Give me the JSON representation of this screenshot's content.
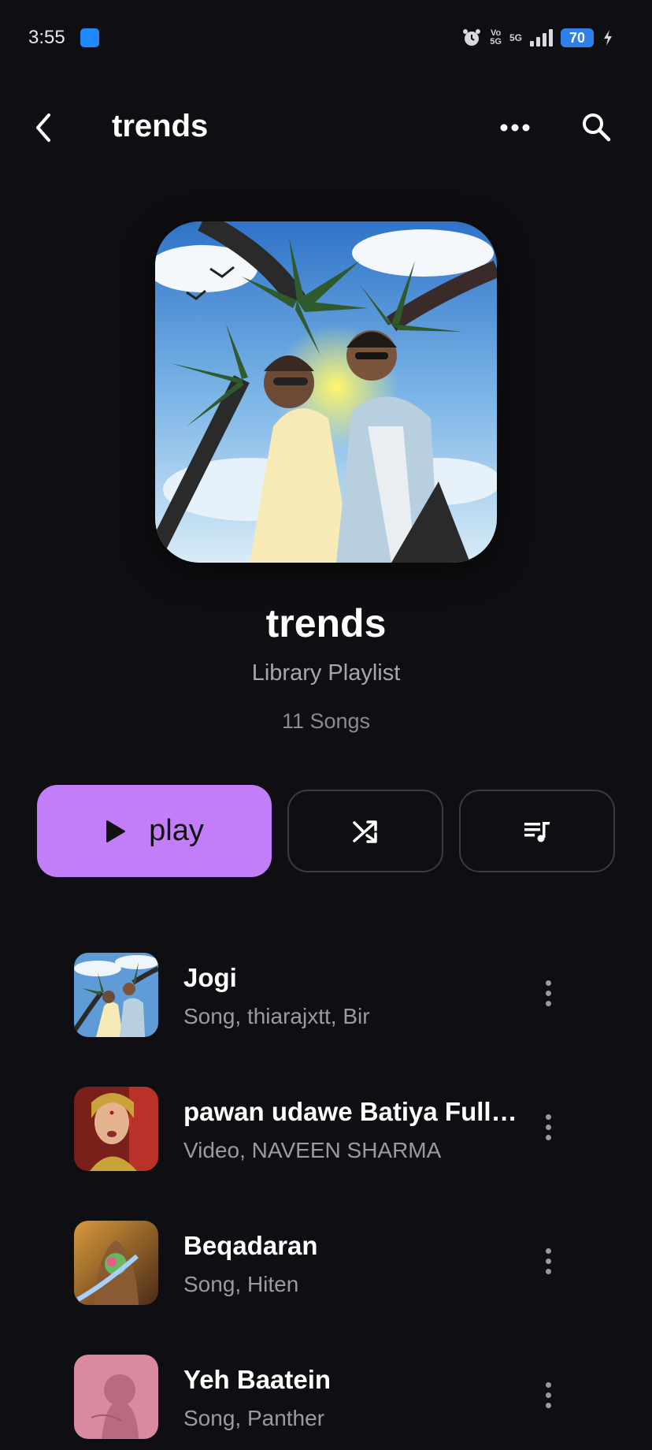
{
  "status_bar": {
    "time": "3:55",
    "volte_top": "Vo",
    "volte_bottom": "5G",
    "network": "5G",
    "battery": "70",
    "icons": [
      "android-app-icon",
      "alarm-icon",
      "signal-icon",
      "battery-icon",
      "charging-icon"
    ]
  },
  "header": {
    "title": "trends",
    "icons": [
      "back-arrow-icon",
      "more-horizontal-icon",
      "search-icon"
    ]
  },
  "playlist": {
    "title": "trends",
    "subtitle": "Library Playlist",
    "count": "11 Songs"
  },
  "actions": {
    "play_label": "play",
    "icons": [
      "play-icon",
      "shuffle-icon",
      "queue-music-icon"
    ]
  },
  "colors": {
    "background": "#0f0f13",
    "accent": "#c17ef8",
    "secondary_text": "#9a9aa2"
  },
  "songs": [
    {
      "title": "Jogi",
      "meta": "Song, thiarajxtt, Bir"
    },
    {
      "title": "pawan udawe Batiya Full s...",
      "meta": "Video, NAVEEN SHARMA"
    },
    {
      "title": "Beqadaran",
      "meta": "Song, Hiten"
    },
    {
      "title": "Yeh Baatein",
      "meta": "Song, Panther"
    }
  ]
}
